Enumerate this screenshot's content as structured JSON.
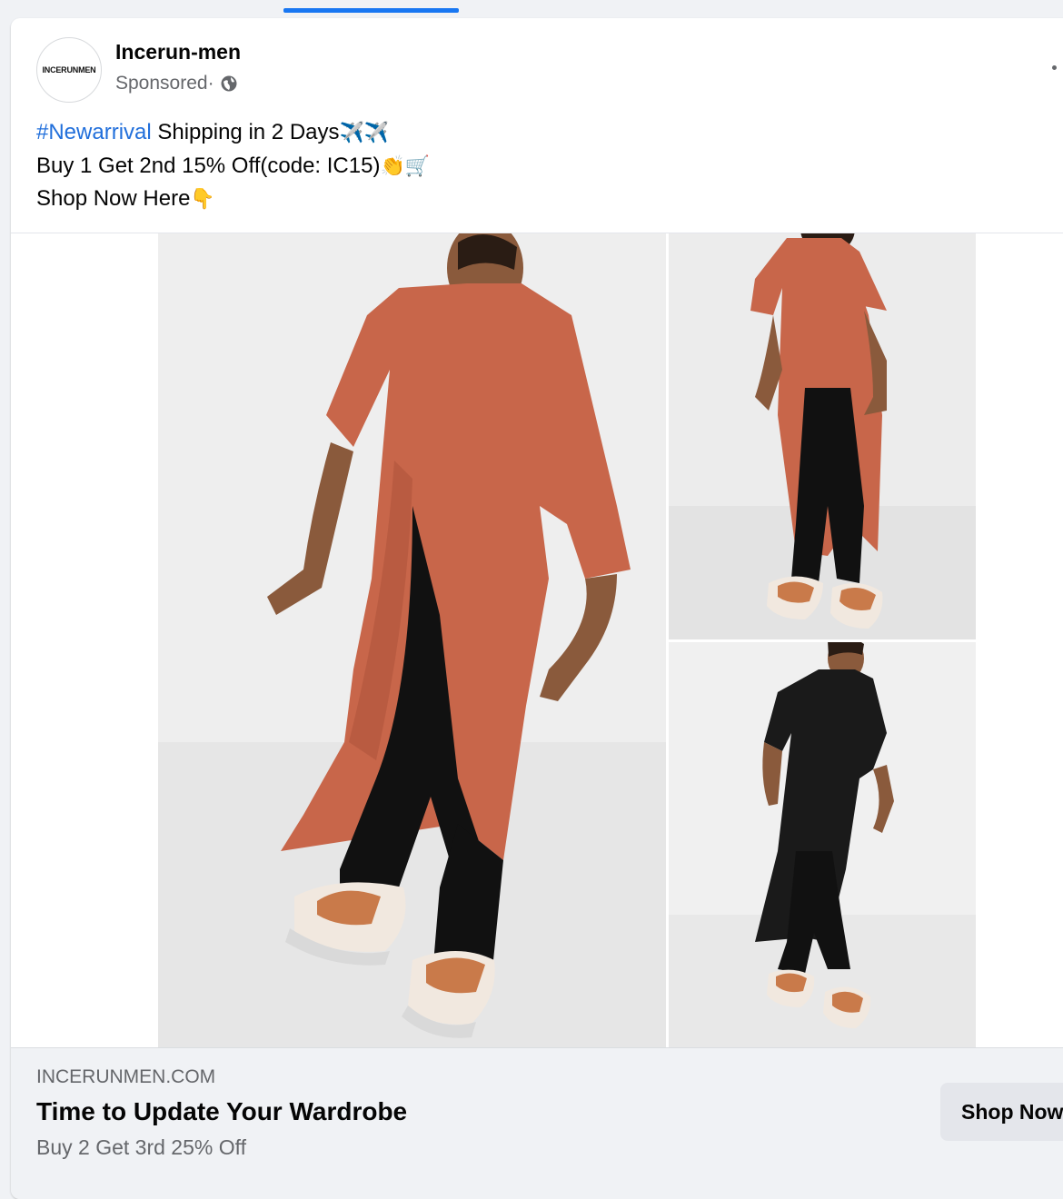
{
  "post": {
    "page_name": "Incerun-men",
    "avatar_text": "INCERUNMEN",
    "sponsored_label": "Sponsored",
    "separator": " · ",
    "icon_privacy": "globe-icon",
    "text": {
      "hashtag": "#Newarrival",
      "line1_rest": " Shipping in 2 Days",
      "line1_emoji": "✈️✈️",
      "line2": "Buy 1 Get 2nd 15% Off(code: IC15)",
      "line2_emoji": "👏🛒",
      "line3": "Shop Now Here",
      "line3_emoji": "👇"
    }
  },
  "media": {
    "images": [
      {
        "name": "orange-split-tee-front",
        "garment_color": "#c8664a"
      },
      {
        "name": "orange-split-tee-back",
        "garment_color": "#c8664a"
      },
      {
        "name": "black-split-tee-front",
        "garment_color": "#1a1a1a"
      }
    ]
  },
  "link": {
    "domain": "INCERUNMEN.COM",
    "headline": "Time to Update Your Wardrobe",
    "description": "Buy 2 Get 3rd 25% Off",
    "cta_label": "Shop Now"
  },
  "colors": {
    "accent": "#1877f2",
    "hashtag": "#216fdb",
    "secondary_text": "#65676b"
  }
}
